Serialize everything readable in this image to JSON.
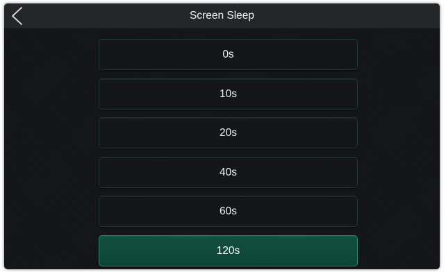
{
  "header": {
    "title": "Screen Sleep",
    "back_icon": "chevron-left-icon"
  },
  "options": [
    {
      "label": "0s",
      "selected": false
    },
    {
      "label": "10s",
      "selected": false
    },
    {
      "label": "20s",
      "selected": false
    },
    {
      "label": "40s",
      "selected": false
    },
    {
      "label": "60s",
      "selected": false
    },
    {
      "label": "120s",
      "selected": true
    }
  ],
  "colors": {
    "background": "#14171a",
    "header": "#24272a",
    "option_bg": "#141617",
    "selected_bg": "#0e4434",
    "selected_border": "#2c8a67",
    "text": "#f0f0f0"
  }
}
